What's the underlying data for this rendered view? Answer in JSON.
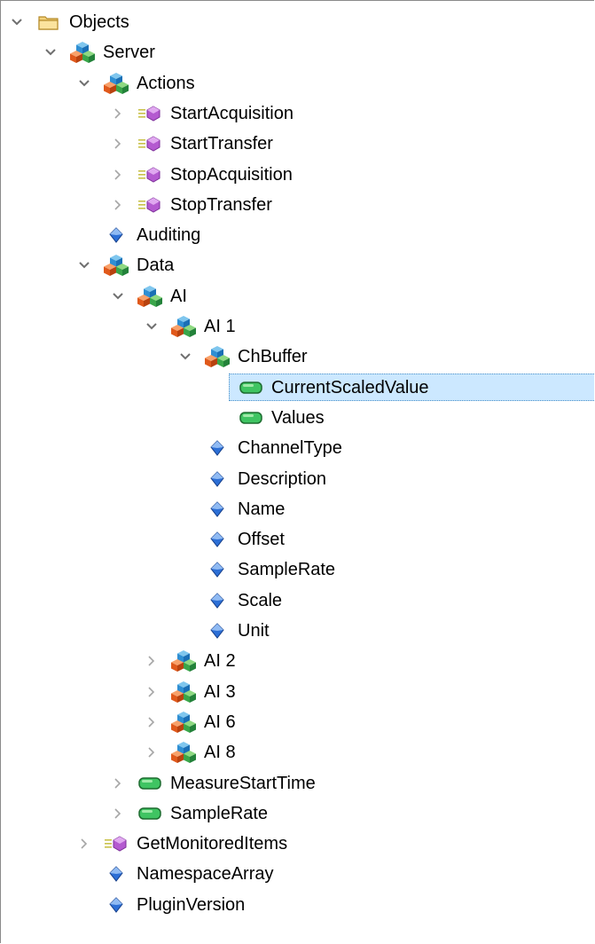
{
  "tree": {
    "nodes": [
      {
        "label": "Objects",
        "depth": 0,
        "icon": "folder-icon",
        "expander": "expanded"
      },
      {
        "label": "Server",
        "depth": 1,
        "icon": "object-icon",
        "expander": "expanded"
      },
      {
        "label": "Actions",
        "depth": 2,
        "icon": "object-icon",
        "expander": "expanded"
      },
      {
        "label": "StartAcquisition",
        "depth": 3,
        "icon": "method-icon",
        "expander": "collapsed"
      },
      {
        "label": "StartTransfer",
        "depth": 3,
        "icon": "method-icon",
        "expander": "collapsed"
      },
      {
        "label": "StopAcquisition",
        "depth": 3,
        "icon": "method-icon",
        "expander": "collapsed"
      },
      {
        "label": "StopTransfer",
        "depth": 3,
        "icon": "method-icon",
        "expander": "collapsed"
      },
      {
        "label": "Auditing",
        "depth": 2,
        "icon": "property-icon",
        "expander": "none"
      },
      {
        "label": "Data",
        "depth": 2,
        "icon": "object-icon",
        "expander": "expanded"
      },
      {
        "label": "AI",
        "depth": 3,
        "icon": "object-icon",
        "expander": "expanded"
      },
      {
        "label": "AI 1",
        "depth": 4,
        "icon": "object-icon",
        "expander": "expanded"
      },
      {
        "label": "ChBuffer",
        "depth": 5,
        "icon": "object-icon",
        "expander": "expanded"
      },
      {
        "label": "CurrentScaledValue",
        "depth": 6,
        "icon": "variable-icon",
        "expander": "none",
        "selected": true
      },
      {
        "label": "Values",
        "depth": 6,
        "icon": "variable-icon",
        "expander": "none"
      },
      {
        "label": "ChannelType",
        "depth": 5,
        "icon": "property-icon",
        "expander": "none"
      },
      {
        "label": "Description",
        "depth": 5,
        "icon": "property-icon",
        "expander": "none"
      },
      {
        "label": "Name",
        "depth": 5,
        "icon": "property-icon",
        "expander": "none"
      },
      {
        "label": "Offset",
        "depth": 5,
        "icon": "property-icon",
        "expander": "none"
      },
      {
        "label": "SampleRate",
        "depth": 5,
        "icon": "property-icon",
        "expander": "none"
      },
      {
        "label": "Scale",
        "depth": 5,
        "icon": "property-icon",
        "expander": "none"
      },
      {
        "label": "Unit",
        "depth": 5,
        "icon": "property-icon",
        "expander": "none"
      },
      {
        "label": "AI 2",
        "depth": 4,
        "icon": "object-icon",
        "expander": "collapsed"
      },
      {
        "label": "AI 3",
        "depth": 4,
        "icon": "object-icon",
        "expander": "collapsed"
      },
      {
        "label": "AI 6",
        "depth": 4,
        "icon": "object-icon",
        "expander": "collapsed"
      },
      {
        "label": "AI 8",
        "depth": 4,
        "icon": "object-icon",
        "expander": "collapsed"
      },
      {
        "label": "MeasureStartTime",
        "depth": 3,
        "icon": "variable-icon",
        "expander": "collapsed"
      },
      {
        "label": "SampleRate",
        "depth": 3,
        "icon": "variable-icon",
        "expander": "collapsed"
      },
      {
        "label": "GetMonitoredItems",
        "depth": 2,
        "icon": "method-icon",
        "expander": "collapsed"
      },
      {
        "label": "NamespaceArray",
        "depth": 2,
        "icon": "property-icon",
        "expander": "none"
      },
      {
        "label": "PluginVersion",
        "depth": 2,
        "icon": "property-icon",
        "expander": "none"
      }
    ]
  },
  "colors": {
    "selection_bg": "#cce8ff",
    "selection_border": "#4a90c8",
    "expander": "#6f6f6f",
    "expander_collapsed": "#a6a6a6"
  }
}
